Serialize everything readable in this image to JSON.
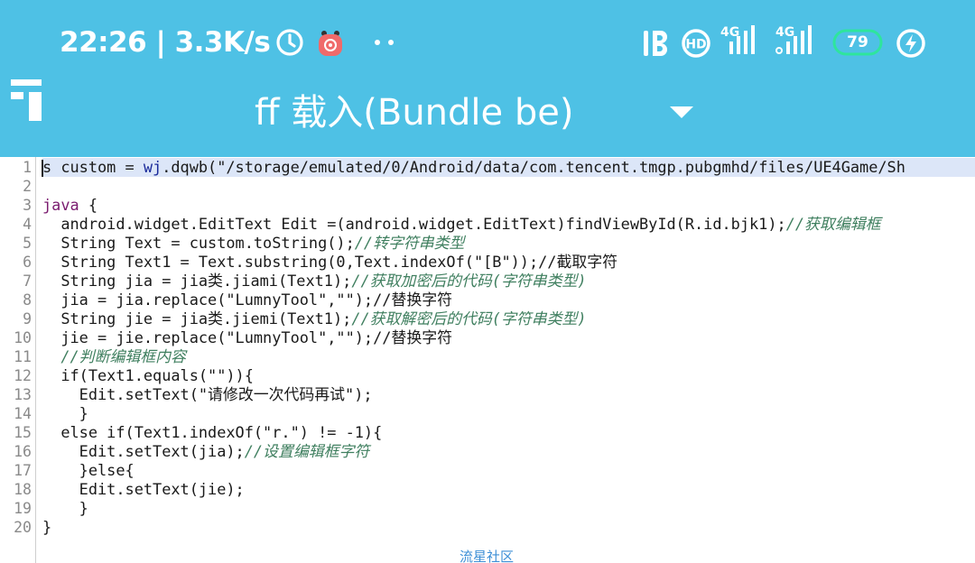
{
  "status_bar": {
    "time": "22:26 | 3.3K/s",
    "network_1": "4G",
    "network_2": "4G",
    "battery_level": "79",
    "icons": [
      "clock-icon",
      "app-notification-icon",
      "more-dots-icon",
      "bluetooth-icon",
      "hd-icon",
      "signal-icon",
      "signal-icon",
      "battery-icon",
      "charging-icon"
    ]
  },
  "toolbar": {
    "menu_icon": "menu-icon",
    "title": "ff 载入(Bundle be)",
    "dropdown_icon": "chevron-down-icon"
  },
  "editor": {
    "line_numbers": [
      "1",
      "2",
      "3",
      "4",
      "5",
      "6",
      "7",
      "8",
      "9",
      "10",
      "11",
      "12",
      "13",
      "14",
      "15",
      "16",
      "17",
      "18",
      "19",
      "20"
    ],
    "lines": [
      {
        "segments": [
          {
            "t": "s custom = ",
            "c": ""
          },
          {
            "t": "wj",
            "c": "fn"
          },
          {
            "t": ".dqwb(\"/storage/emulated/0/Android/data/com.tencent.tmgp.pubgmhd/files/UE4Game/Sh",
            "c": ""
          }
        ]
      },
      {
        "segments": []
      },
      {
        "segments": [
          {
            "t": "java",
            "c": "kw"
          },
          {
            "t": " {",
            "c": ""
          }
        ]
      },
      {
        "segments": [
          {
            "t": "  android.widget.EditText Edit =(android.widget.EditText)findViewById(R.id.bjk1);",
            "c": ""
          },
          {
            "t": "//获取编辑框",
            "c": "cm"
          }
        ]
      },
      {
        "segments": [
          {
            "t": "  String Text = custom.toString();",
            "c": ""
          },
          {
            "t": "//转字符串类型",
            "c": "cm"
          }
        ]
      },
      {
        "segments": [
          {
            "t": "  String Text1 = Text.substring(0,Text.indexOf(\"[B\"));//截取字符",
            "c": ""
          }
        ]
      },
      {
        "segments": [
          {
            "t": "  String jia = jia类.jiami(Text1);",
            "c": ""
          },
          {
            "t": "//获取加密后的代码(字符串类型)",
            "c": "cm"
          }
        ]
      },
      {
        "segments": [
          {
            "t": "  jia = jia.replace(\"LumnyTool\",\"\");//替换字符",
            "c": ""
          }
        ]
      },
      {
        "segments": [
          {
            "t": "  String jie = jia类.jiemi(Text1);",
            "c": ""
          },
          {
            "t": "//获取解密后的代码(字符串类型)",
            "c": "cm"
          }
        ]
      },
      {
        "segments": [
          {
            "t": "  jie = jie.replace(\"LumnyTool\",\"\");//替换字符",
            "c": ""
          }
        ]
      },
      {
        "segments": [
          {
            "t": "  ",
            "c": ""
          },
          {
            "t": "//判断编辑框内容",
            "c": "cm"
          }
        ]
      },
      {
        "segments": [
          {
            "t": "  if(Text1.equals(\"\")){",
            "c": ""
          }
        ]
      },
      {
        "segments": [
          {
            "t": "    Edit.setText(\"请修改一次代码再试\");",
            "c": ""
          }
        ]
      },
      {
        "segments": [
          {
            "t": "    }",
            "c": ""
          }
        ]
      },
      {
        "segments": [
          {
            "t": "  else if(Text1.indexOf(\"r.\") != -1){",
            "c": ""
          }
        ]
      },
      {
        "segments": [
          {
            "t": "    Edit.setText(jia);",
            "c": ""
          },
          {
            "t": "//设置编辑框字符",
            "c": "cm"
          }
        ]
      },
      {
        "segments": [
          {
            "t": "    }else{",
            "c": ""
          }
        ]
      },
      {
        "segments": [
          {
            "t": "    Edit.setText(jie);",
            "c": ""
          }
        ]
      },
      {
        "segments": [
          {
            "t": "    }",
            "c": ""
          }
        ]
      },
      {
        "segments": [
          {
            "t": "}",
            "c": ""
          }
        ]
      }
    ],
    "colors": {
      "keyword": "#7a1b6f",
      "identifier": "#1a2a9a",
      "comment": "#3f7f5f",
      "highlight": "#dce6f8"
    }
  },
  "footer": {
    "link": "流星社区"
  },
  "theme": {
    "header_bg": "#4ec1e5",
    "battery_ring": "#2ee59d"
  }
}
